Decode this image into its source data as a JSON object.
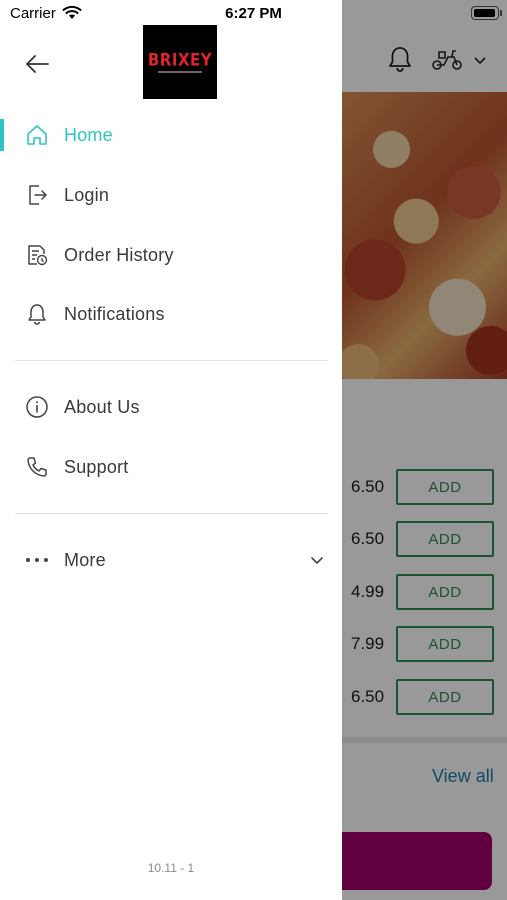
{
  "status_bar": {
    "carrier": "Carrier",
    "time": "6:27 PM"
  },
  "drawer": {
    "logo_text": "BRIXEY",
    "menu": [
      {
        "label": "Home",
        "icon": "home-icon",
        "active": true
      },
      {
        "label": "Login",
        "icon": "login-icon"
      },
      {
        "label": "Order History",
        "icon": "order-history-icon"
      },
      {
        "label": "Notifications",
        "icon": "bell-icon"
      },
      {
        "label": "About Us",
        "icon": "info-icon"
      },
      {
        "label": "Support",
        "icon": "phone-icon"
      },
      {
        "label": "More",
        "icon": "more-dots-icon"
      }
    ],
    "version": "10.11 - 1"
  },
  "background": {
    "items": [
      {
        "price": "6.50",
        "button": "ADD"
      },
      {
        "price": "6.50",
        "button": "ADD"
      },
      {
        "price": "4.99",
        "button": "ADD"
      },
      {
        "price": "7.99",
        "button": "ADD"
      },
      {
        "price": "6.50",
        "button": "ADD"
      }
    ],
    "view_all": "View all"
  },
  "colors": {
    "accent": "#2ec4c4",
    "add_button": "#2e8b57",
    "cta": "#a1006b",
    "logo_red": "#e0242b"
  }
}
